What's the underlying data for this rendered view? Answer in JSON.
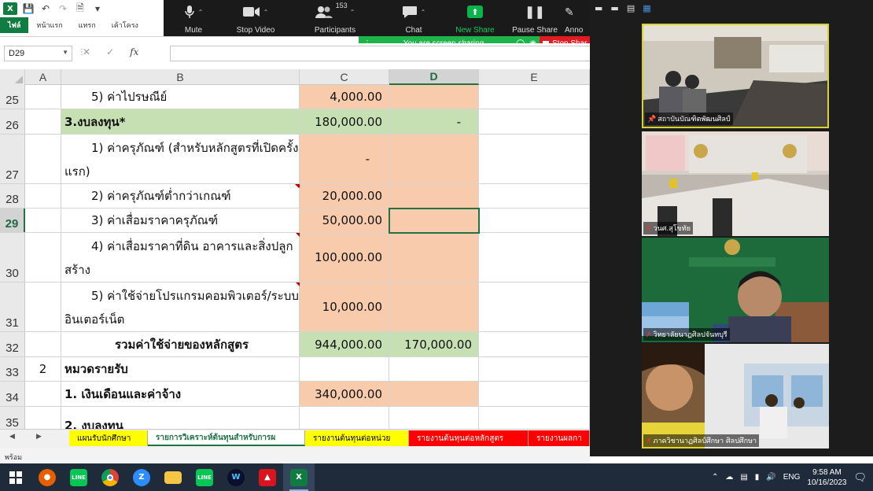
{
  "excel": {
    "file_tab": "ไฟล์",
    "ribbon_tabs": [
      "หน้าแรก",
      "แทรก",
      "เค้าโครง"
    ],
    "name_box": "D29",
    "fx_label": "fx",
    "columns": [
      "A",
      "B",
      "C",
      "D",
      "E"
    ],
    "rows": [
      {
        "num": "25",
        "a": "",
        "b": "5) ค่าไปรษณีย์",
        "c": "4,000.00",
        "d": ""
      },
      {
        "num": "26",
        "a": "",
        "b": "3.งบลงทุน*",
        "c": "180,000.00",
        "d": "-"
      },
      {
        "num": "27",
        "a": "",
        "b": "1) ค่าครุภัณฑ์ (สำหรับหลักสูตรที่เปิดครั้งแรก)",
        "c": "-",
        "d": ""
      },
      {
        "num": "28",
        "a": "",
        "b": "2) ค่าครุภัณฑ์ต่ำกว่าเกณฑ์",
        "c": "20,000.00",
        "d": ""
      },
      {
        "num": "29",
        "a": "",
        "b": "3) ค่าเสื่อมราคาครุภัณฑ์",
        "c": "50,000.00",
        "d": ""
      },
      {
        "num": "30",
        "a": "",
        "b": "4) ค่าเสื่อมราคาที่ดิน อาคารและสิ่งปลูกสร้าง",
        "c": "100,000.00",
        "d": ""
      },
      {
        "num": "31",
        "a": "",
        "b": "5) ค่าใช้จ่ายโปรแกรมคอมพิวเตอร์/ระบบอินเตอร์เน็ต",
        "c": "10,000.00",
        "d": ""
      },
      {
        "num": "32",
        "a": "",
        "b": "รวมค่าใช้จ่ายของหลักสูตร",
        "c": "944,000.00",
        "d": "170,000.00"
      },
      {
        "num": "33",
        "a": "2",
        "b": "หมวดรายรับ",
        "c": "",
        "d": ""
      },
      {
        "num": "34",
        "a": "",
        "b": "1. เงินเดือนและค่าจ้าง",
        "c": "340,000.00",
        "d": ""
      },
      {
        "num": "35",
        "a": "",
        "b": "2. งบลงทุน",
        "c": "",
        "d": ""
      }
    ],
    "sheet_tabs": [
      "แผนรับนักศึกษา",
      "รายการวิเคราะห์ต้นทุนสำหรับการผ",
      "รายงานต้นทุนต่อหน่วย",
      "รายงานต้นทุนต่อหลักสูตร",
      "รายงานผลกา"
    ],
    "status": "พร้อม"
  },
  "zoom": {
    "buttons": {
      "mute": "Mute",
      "stop_video": "Stop Video",
      "participants": "Participants",
      "participants_count": "153",
      "chat": "Chat",
      "new_share": "New Share",
      "pause_share": "Pause Share",
      "annotate": "Anno"
    },
    "sharing_banner": "You are screen sharing",
    "stop_share": "Stop Shar",
    "tiles": [
      {
        "name": "สถาบันบัณฑิตพัฒนศิลป์"
      },
      {
        "name": "วนศ.สุโขทัย"
      },
      {
        "name": "วิทยาลัยนาฏศิลปจันทบุรี"
      },
      {
        "name": "ภาควิชานาฏศิลป์ศึกษา ศิลปศึกษา"
      }
    ]
  },
  "taskbar": {
    "lang": "ENG",
    "time": "9:58 AM",
    "date": "10/16/2023"
  },
  "colors": {
    "excel_green": "#107c41",
    "peach": "#f8cbad",
    "green_fill": "#c6e0b4",
    "zoom_bg": "#1a1a1a",
    "share_green": "#1fb44b",
    "stop_red": "#e21b22"
  }
}
